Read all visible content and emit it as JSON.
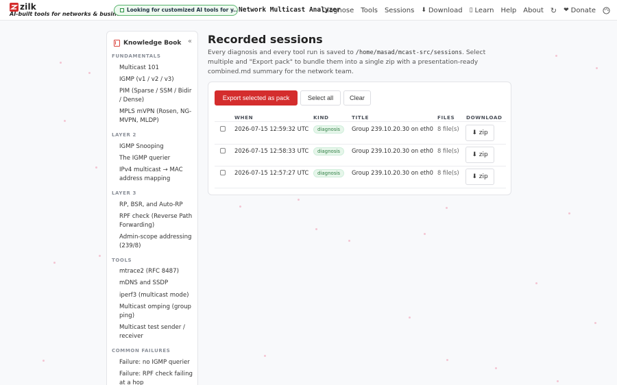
{
  "brand": {
    "name": "zilk",
    "tagline": "AI-built tools for networks & business."
  },
  "promo": {
    "text": "Looking for customized AI tools for y..."
  },
  "app_title": "Network Multicast Analyzer",
  "nav": {
    "items": [
      {
        "label": "Diagnose"
      },
      {
        "label": "Tools"
      },
      {
        "label": "Sessions"
      },
      {
        "label": "Download",
        "icon": "download-icon"
      },
      {
        "label": "Learn",
        "icon": "book-icon"
      },
      {
        "label": "Help"
      },
      {
        "label": "About"
      }
    ],
    "donate_label": "Donate"
  },
  "sidebar": {
    "title": "Knowledge Book",
    "collapse": "«",
    "sections": [
      {
        "title": "FUNDAMENTALS",
        "items": [
          "Multicast 101",
          "IGMP (v1 / v2 / v3)",
          "PIM (Sparse / SSM / Bidir / Dense)",
          "MPLS mVPN (Rosen, NG-MVPN, MLDP)"
        ]
      },
      {
        "title": "LAYER 2",
        "items": [
          "IGMP Snooping",
          "The IGMP querier",
          "IPv4 multicast → MAC address mapping"
        ]
      },
      {
        "title": "LAYER 3",
        "items": [
          "RP, BSR, and Auto-RP",
          "RPF check (Reverse Path Forwarding)",
          "Admin-scope addressing (239/8)"
        ]
      },
      {
        "title": "TOOLS",
        "items": [
          "mtrace2 (RFC 8487)",
          "mDNS and SSDP",
          "iperf3 (multicast mode)",
          "Multicast omping (group ping)",
          "Multicast test sender / receiver"
        ]
      },
      {
        "title": "COMMON FAILURES",
        "items": [
          "Failure: no IGMP querier",
          "Failure: RPF check failing at a hop"
        ]
      }
    ]
  },
  "main": {
    "title": "Recorded sessions",
    "desc_before": "Every diagnosis and every tool run is saved to ",
    "desc_path": "/home/masad/mcast-src/sessions",
    "desc_after": ". Select multiple and \"Export pack\" to bundle them into a single zip with a presentation-ready combined.md summary for the network team.",
    "buttons": {
      "export": "Export selected as pack",
      "select_all": "Select all",
      "clear": "Clear"
    },
    "table": {
      "headers": {
        "when": "WHEN",
        "kind": "KIND",
        "title": "TITLE",
        "files": "FILES",
        "download": "DOWNLOAD"
      },
      "rows": [
        {
          "when": "2026-07-15 12:59:32 UTC",
          "kind": "diagnosis",
          "title": "Group 239.10.20.30 on eth0",
          "files": "8 file(s)",
          "download": "⬇ zip"
        },
        {
          "when": "2026-07-15 12:58:33 UTC",
          "kind": "diagnosis",
          "title": "Group 239.10.20.30 on eth0",
          "files": "8 file(s)",
          "download": "⬇ zip"
        },
        {
          "when": "2026-07-15 12:57:27 UTC",
          "kind": "diagnosis",
          "title": "Group 239.10.20.30 on eth0",
          "files": "8 file(s)",
          "download": "⬇ zip"
        }
      ]
    }
  },
  "colors": {
    "accent": "#d42d2d",
    "badge_bg": "#e6f6ea",
    "badge_text": "#2e7d43",
    "promo_border": "#58b36c"
  }
}
